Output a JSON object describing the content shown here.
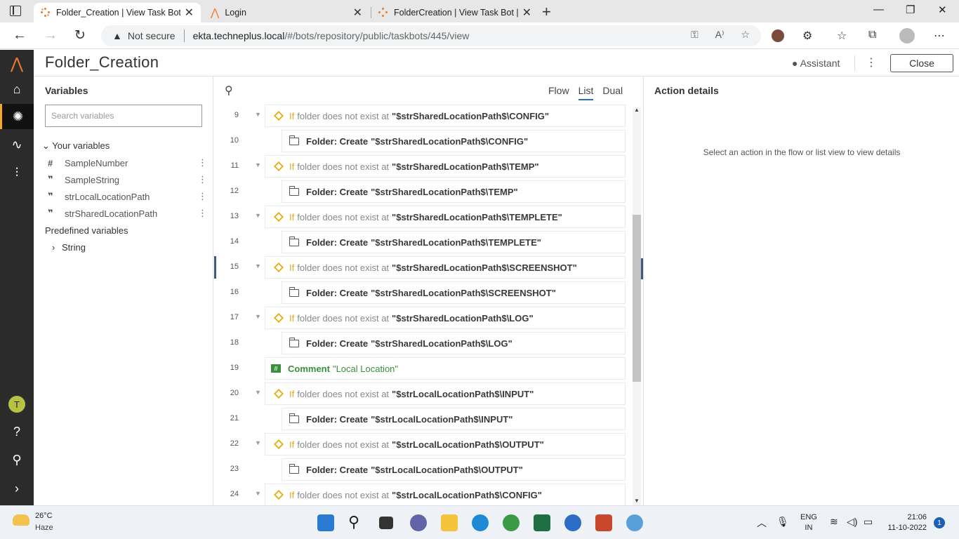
{
  "browser": {
    "tabs": [
      {
        "title": "Folder_Creation | View Task Bot |",
        "active": true
      },
      {
        "title": "Login",
        "active": false
      },
      {
        "title": "FolderCreation | View Task Bot |",
        "active": false
      }
    ],
    "security_label": "Not secure",
    "url_host": "ekta.techneplus.local",
    "url_path": "/#/bots/repository/public/taskbots/445/view"
  },
  "header": {
    "title": "Folder_Creation",
    "assistant_label": "Assistant",
    "close_label": "Close"
  },
  "variables": {
    "title": "Variables",
    "search_placeholder": "Search variables",
    "your_variables_label": "Your variables",
    "items": [
      {
        "icon": "number-icon",
        "name": "SampleNumber"
      },
      {
        "icon": "string-icon",
        "name": "SampleString"
      },
      {
        "icon": "string-icon",
        "name": "strLocalLocationPath"
      },
      {
        "icon": "string-icon",
        "name": "strSharedLocationPath"
      }
    ],
    "predefined_label": "Predefined variables",
    "predefined_items": [
      {
        "name": "String"
      }
    ]
  },
  "view_tabs": {
    "flow": "Flow",
    "list": "List",
    "dual": "Dual",
    "active": "list"
  },
  "lines": [
    {
      "num": "9",
      "type": "if",
      "text": "folder does not exist at",
      "value": "\"$strSharedLocationPath$\\CONFIG\""
    },
    {
      "num": "10",
      "type": "folder",
      "label": "Folder: Create",
      "value": "\"$strSharedLocationPath$\\CONFIG\""
    },
    {
      "num": "11",
      "type": "if",
      "text": "folder does not exist at",
      "value": "\"$strSharedLocationPath$\\TEMP\""
    },
    {
      "num": "12",
      "type": "folder",
      "label": "Folder: Create",
      "value": "\"$strSharedLocationPath$\\TEMP\""
    },
    {
      "num": "13",
      "type": "if",
      "text": "folder does not exist at",
      "value": "\"$strSharedLocationPath$\\TEMPLETE\""
    },
    {
      "num": "14",
      "type": "folder",
      "label": "Folder: Create",
      "value": "\"$strSharedLocationPath$\\TEMPLETE\""
    },
    {
      "num": "15",
      "type": "if",
      "text": "folder does not exist at",
      "value": "\"$strSharedLocationPath$\\SCREENSHOT\""
    },
    {
      "num": "16",
      "type": "folder",
      "label": "Folder: Create",
      "value": "\"$strSharedLocationPath$\\SCREENSHOT\""
    },
    {
      "num": "17",
      "type": "if",
      "text": "folder does not exist at",
      "value": "\"$strSharedLocationPath$\\LOG\""
    },
    {
      "num": "18",
      "type": "folder",
      "label": "Folder: Create",
      "value": "\"$strSharedLocationPath$\\LOG\""
    },
    {
      "num": "19",
      "type": "comment",
      "label": "Comment",
      "value": "\"Local Location\""
    },
    {
      "num": "20",
      "type": "if",
      "text": "folder does not exist at",
      "value": "\"$strLocalLocationPath$\\INPUT\""
    },
    {
      "num": "21",
      "type": "folder",
      "label": "Folder: Create",
      "value": "\"$strLocalLocationPath$\\INPUT\""
    },
    {
      "num": "22",
      "type": "if",
      "text": "folder does not exist at",
      "value": "\"$strLocalLocationPath$\\OUTPUT\""
    },
    {
      "num": "23",
      "type": "folder",
      "label": "Folder: Create",
      "value": "\"$strLocalLocationPath$\\OUTPUT\""
    },
    {
      "num": "24",
      "type": "if",
      "text": "folder does not exist at",
      "value": "\"$strLocalLocationPath$\\CONFIG\""
    }
  ],
  "if_keyword": "If",
  "details": {
    "title": "Action details",
    "empty_message": "Select an action in the flow or list view to view details"
  },
  "taskbar": {
    "temperature": "26°C",
    "weather": "Haze",
    "lang_line1": "ENG",
    "lang_line2": "IN",
    "time": "21:06",
    "date": "11-10-2022",
    "notification_count": "1"
  },
  "colors": {
    "accent": "#2a6ebb",
    "if_diamond": "#e6b325",
    "comment": "#3a8f3a",
    "rail": "#2b2b2b"
  }
}
